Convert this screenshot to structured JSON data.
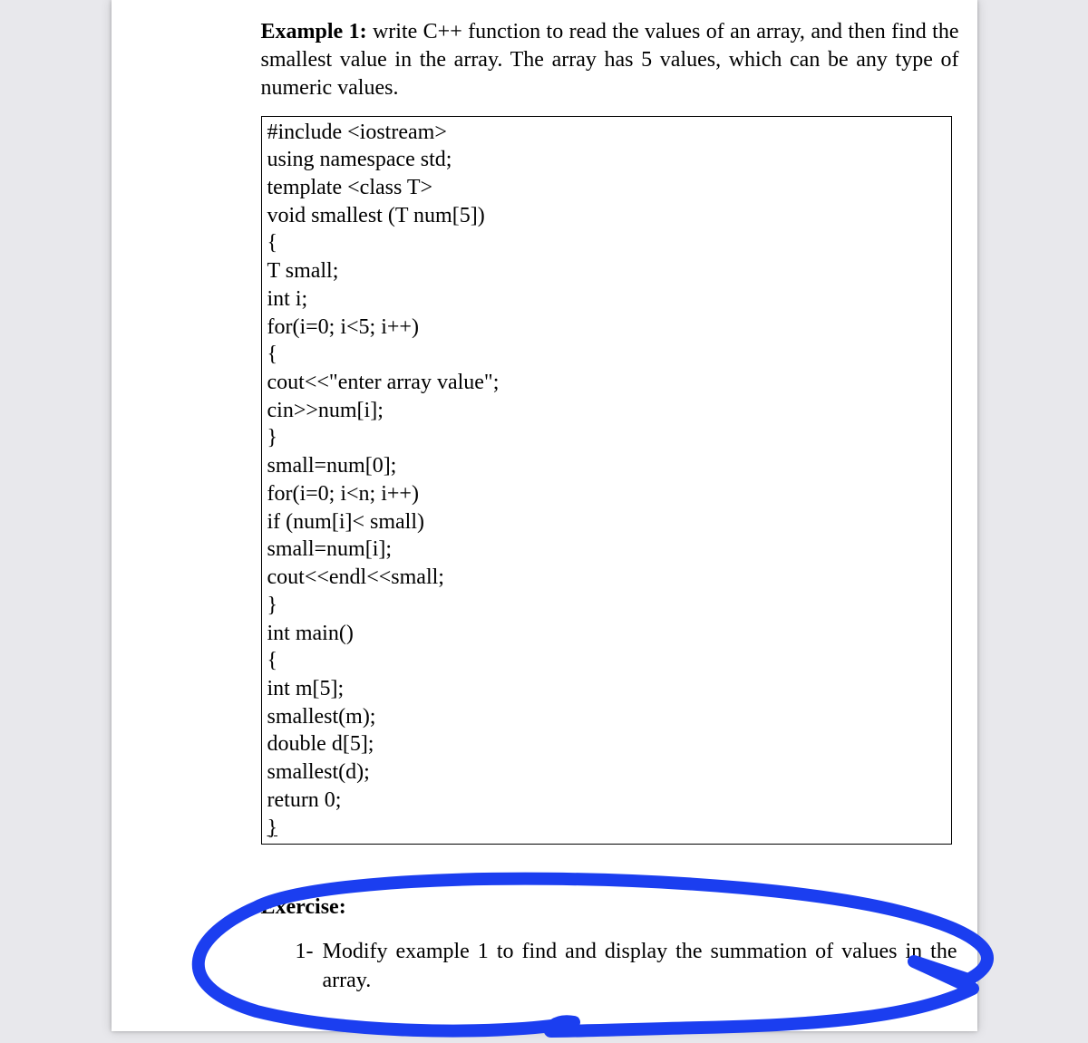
{
  "example": {
    "label": "Example 1:",
    "text": " write C++ function to read the values of an array, and then find the smallest value in the array. The array has 5 values, which can be any type of numeric values."
  },
  "code": {
    "lines": [
      "#include <iostream>",
      "using namespace std;",
      "template <class T>",
      "void smallest (T num[5])",
      "{",
      "T small;",
      "int i;",
      "for(i=0; i<5; i++)",
      "{",
      "cout<<\"enter array value\";",
      "cin>>num[i];",
      "}",
      "small=num[0];",
      "for(i=0; i<n; i++)",
      "if (num[i]< small)",
      "small=num[i];",
      "cout<<endl<<small;",
      "}",
      "int main()",
      "{",
      "int m[5];",
      "smallest(m);",
      "double d[5];",
      "smallest(d);",
      "return 0;",
      "}"
    ],
    "last_line_underlined": true
  },
  "exercise": {
    "heading": "Exercise:",
    "items": [
      {
        "num": "1-",
        "text": "Modify example 1 to find and display the summation of values in the array."
      }
    ]
  },
  "annotation": {
    "color": "#1b3ef0",
    "description": "hand-drawn-circle-around-exercise"
  }
}
